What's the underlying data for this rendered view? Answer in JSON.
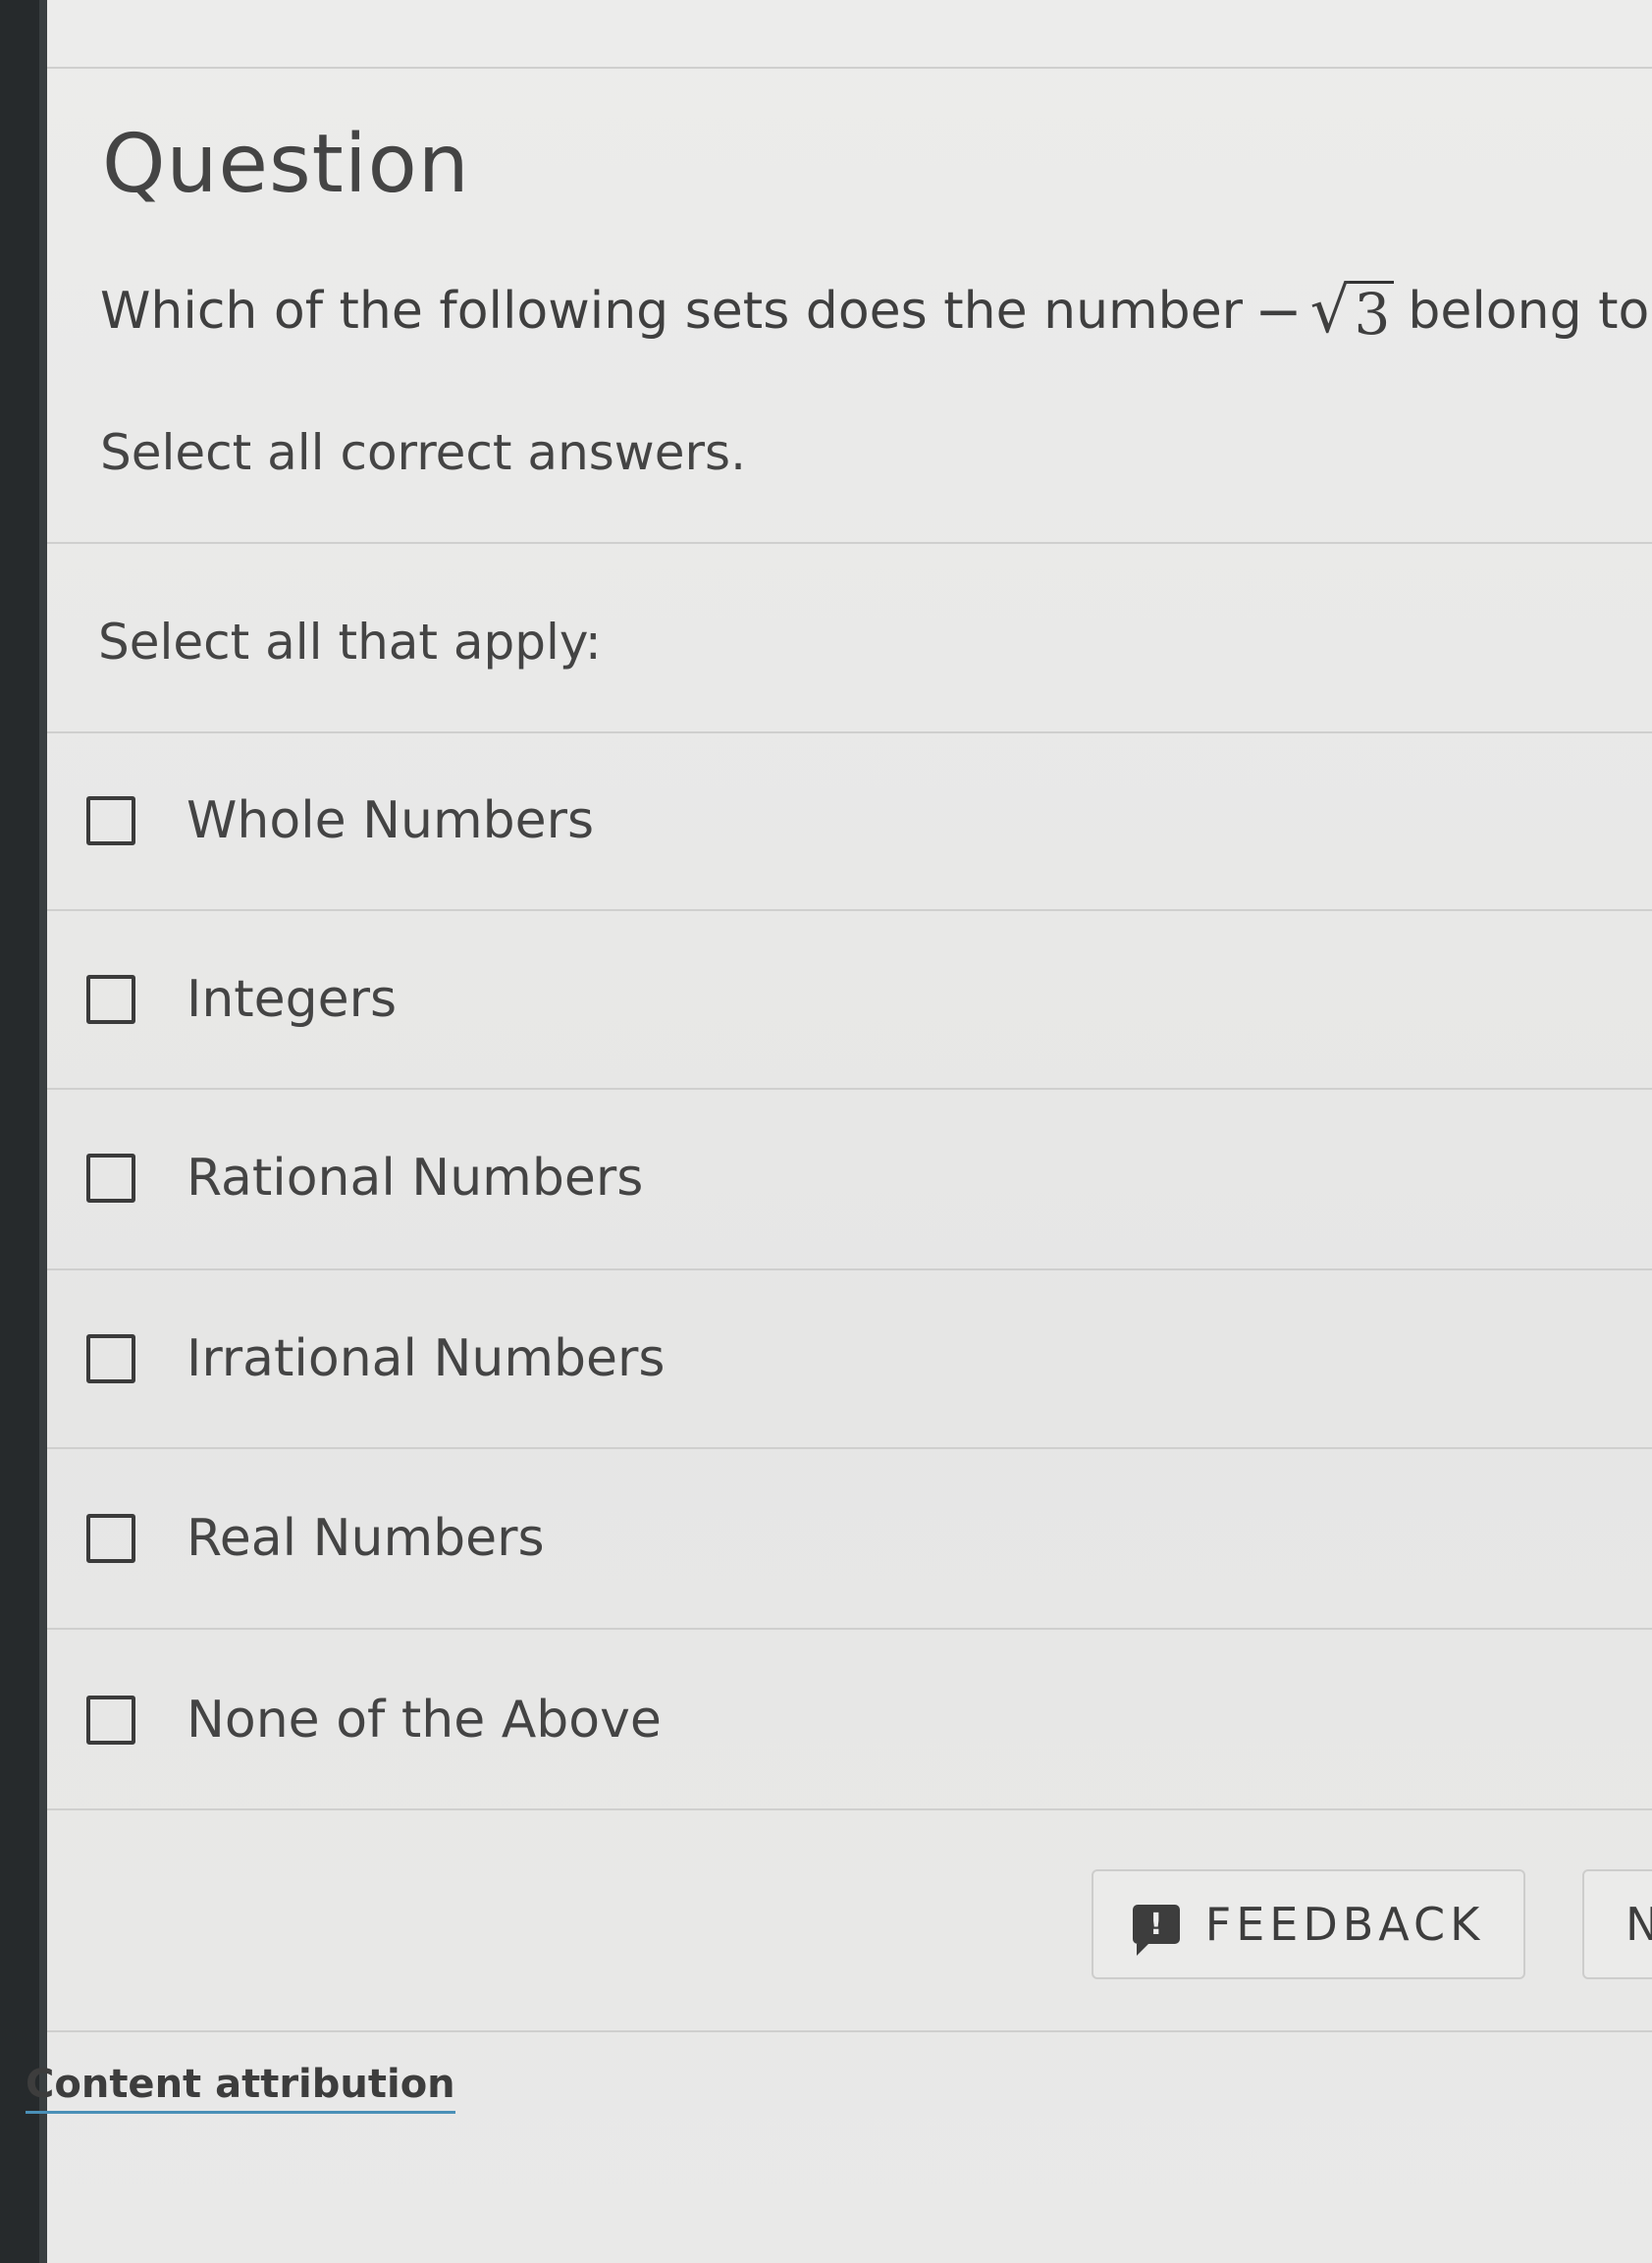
{
  "header": {
    "title": "Question"
  },
  "question": {
    "text_before": "Which of the following sets does the number",
    "math_minus": "−",
    "math_radical": "√",
    "math_radicand": "3",
    "text_after": "belong to?",
    "instruction": "Select all correct answers."
  },
  "answers": {
    "prompt": "Select all that apply:",
    "options": [
      {
        "label": "Whole Numbers",
        "checked": false
      },
      {
        "label": "Integers",
        "checked": false
      },
      {
        "label": "Rational Numbers",
        "checked": false
      },
      {
        "label": "Irrational Numbers",
        "checked": false
      },
      {
        "label": "Real Numbers",
        "checked": false
      },
      {
        "label": "None of the Above",
        "checked": false
      }
    ]
  },
  "footer": {
    "feedback_label": "FEEDBACK",
    "feedback_icon": "!",
    "next_label_partial": "N",
    "content_attribution": "Content attribution"
  }
}
